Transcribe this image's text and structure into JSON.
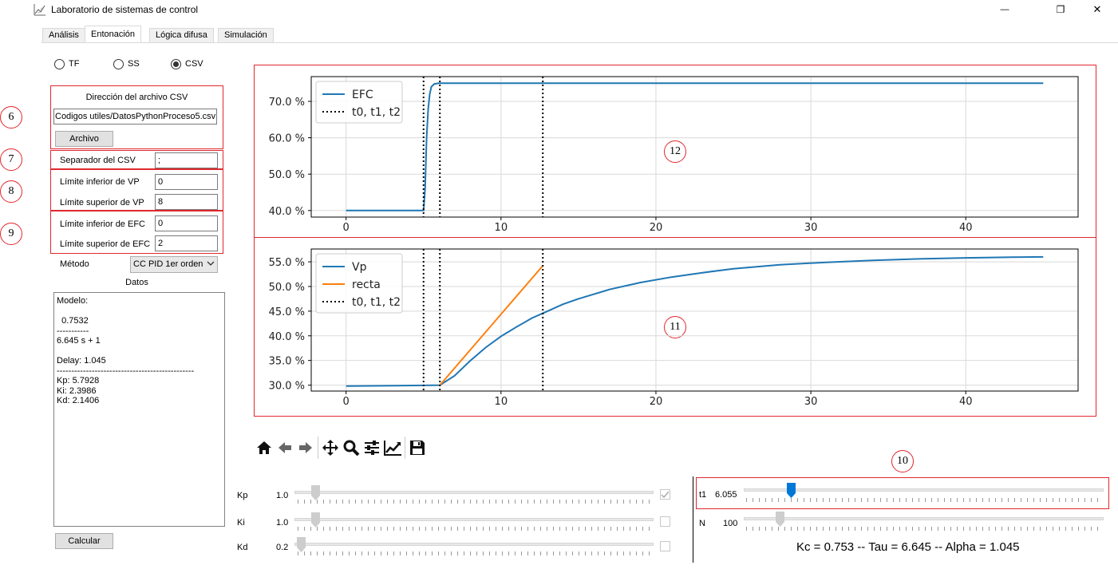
{
  "window": {
    "title": "Laboratorio de sistemas de control",
    "minimize_glyph": "—",
    "maximize_glyph": "❐",
    "close_glyph": "✕"
  },
  "tabs": [
    {
      "label": "Análisis",
      "active": false
    },
    {
      "label": "Entonación",
      "active": true
    },
    {
      "label": "Lógica difusa",
      "active": false
    },
    {
      "label": "Simulación",
      "active": false
    }
  ],
  "source_options": [
    {
      "label": "TF",
      "selected": false
    },
    {
      "label": "SS",
      "selected": false
    },
    {
      "label": "CSV",
      "selected": true
    }
  ],
  "annotations": {
    "n6": "6",
    "n7": "7",
    "n8": "8",
    "n9": "9",
    "n10": "10",
    "n11": "11",
    "n12": "12"
  },
  "csv": {
    "path_label": "Dirección del archivo CSV",
    "path_value": "Codigos utiles/DatosPythonProceso5.csv",
    "file_button": "Archivo",
    "separator_label": "Separador del CSV",
    "separator_value": ";"
  },
  "limits": {
    "vp_low_label": "Límite inferior de VP",
    "vp_low_value": "0",
    "vp_high_label": "Límite superior de VP",
    "vp_high_value": "8",
    "efc_low_label": "Límite inferior de EFC",
    "efc_low_value": "0",
    "efc_high_label": "Límite superior de EFC",
    "efc_high_value": "2"
  },
  "method": {
    "label": "Método",
    "value": "CC PID 1er orden"
  },
  "datos": {
    "title": "Datos",
    "text": "Modelo:\n\n  0.7532\n-----------\n6.645 s + 1\n\nDelay: 1.045\n-----------------------------------------------\nKp: 5.7928\nKi: 2.3986\nKd: 2.1406"
  },
  "calc_button": "Calcular",
  "toolbar": {
    "icons": [
      "home-icon",
      "back-icon",
      "forward-icon",
      "pan-icon",
      "zoom-icon",
      "configure-subplots-icon",
      "edit-axis-icon",
      "save-icon"
    ]
  },
  "pid_sliders": [
    {
      "label": "Kp",
      "value": "1.0",
      "level": 0.05,
      "checked": true
    },
    {
      "label": "Ki",
      "value": "1.0",
      "level": 0.05,
      "checked": false
    },
    {
      "label": "Kd",
      "value": "0.2",
      "level": 0.01,
      "checked": false
    }
  ],
  "right_sliders": [
    {
      "label": "t1",
      "value": "6.055",
      "level": 0.13,
      "active": true
    },
    {
      "label": "N",
      "value": "100",
      "level": 0.1,
      "active": false
    }
  ],
  "result_text": "Kc = 0.753 -- Tau = 6.645 -- Alpha = 1.045",
  "colors": {
    "blue": "#1f77b4",
    "orange": "#ff7f0e",
    "annot_red": "#e0282e",
    "slider_active": "#0078d7"
  },
  "chart_data": [
    {
      "type": "line",
      "xlim": [
        -2.25,
        47.25
      ],
      "ylim": [
        38.2,
        76.8
      ],
      "xticks": [
        0,
        10,
        20,
        30,
        40
      ],
      "yticks": [
        40,
        50,
        60,
        70
      ],
      "ytick_labels": [
        "40.0 %",
        "50.0 %",
        "60.0 %",
        "70.0 %"
      ],
      "grid": true,
      "legend": "top-left",
      "series": [
        {
          "name": "EFC",
          "color": "#1f77b4",
          "x": [
            0,
            5.0,
            5.1,
            5.2,
            5.3,
            5.4,
            5.5,
            5.7,
            6.0,
            7,
            45
          ],
          "y": [
            40,
            40,
            46,
            60,
            68,
            72,
            74,
            74.8,
            75,
            75,
            75
          ]
        }
      ],
      "vlines": {
        "name": "t0, t1, t2",
        "x": [
          5.0,
          6.055,
          12.7
        ]
      }
    },
    {
      "type": "line",
      "xlim": [
        -2.25,
        47.25
      ],
      "ylim": [
        28.8,
        57.6
      ],
      "xticks": [
        0,
        10,
        20,
        30,
        40
      ],
      "yticks": [
        30,
        35,
        40,
        45,
        50,
        55
      ],
      "ytick_labels": [
        "30.0 %",
        "35.0 %",
        "40.0 %",
        "45.0 %",
        "50.0 %",
        "55.0 %"
      ],
      "grid": true,
      "legend": "top-left",
      "series": [
        {
          "name": "Vp",
          "color": "#1f77b4",
          "x": [
            0,
            5,
            6.055,
            7,
            8,
            9,
            10,
            11,
            12,
            13,
            14,
            15,
            17,
            19,
            21,
            23,
            25,
            28,
            31,
            34,
            37,
            40,
            43,
            45
          ],
          "y": [
            29.8,
            29.95,
            30.0,
            31.9,
            34.9,
            37.6,
            39.9,
            41.8,
            43.6,
            45.0,
            46.4,
            47.5,
            49.4,
            50.8,
            51.9,
            52.8,
            53.6,
            54.4,
            54.9,
            55.3,
            55.6,
            55.8,
            55.95,
            56.0
          ]
        },
        {
          "name": "recta",
          "color": "#ff7f0e",
          "x": [
            6.055,
            12.7
          ],
          "y": [
            30.0,
            54.2
          ]
        }
      ],
      "vlines": {
        "name": "t0, t1, t2",
        "x": [
          5.0,
          6.055,
          12.7
        ]
      }
    }
  ]
}
